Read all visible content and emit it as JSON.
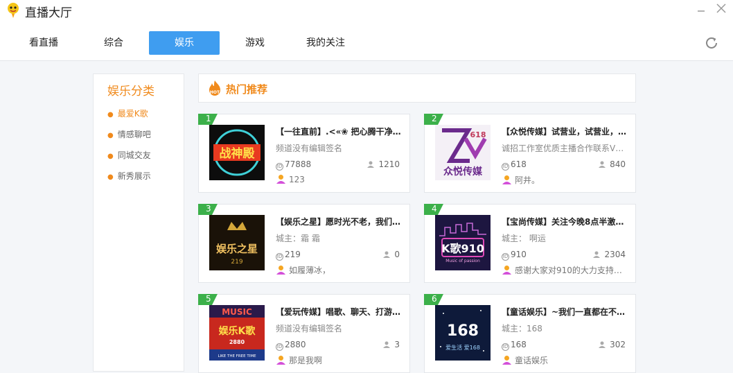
{
  "app": {
    "title": "直播大厅"
  },
  "tabs": [
    {
      "label": "看直播"
    },
    {
      "label": "综合"
    },
    {
      "label": "娱乐"
    },
    {
      "label": "游戏"
    },
    {
      "label": "我的关注"
    }
  ],
  "active_tab": "娱乐",
  "sidebar": {
    "title": "娱乐分类",
    "items": [
      {
        "label": "最爱K歌"
      },
      {
        "label": "情感聊吧"
      },
      {
        "label": "同城交友"
      },
      {
        "label": "新秀展示"
      }
    ],
    "active_item": "最爱K歌"
  },
  "section": {
    "title": "热门推荐",
    "badge": "HOT"
  },
  "cards": [
    {
      "rank": "1",
      "title": "【一往直前】.<«❀ 把心腾干净…",
      "subtitle": "频道没有编辑签名",
      "room_id": "77888",
      "viewers": "1210",
      "host": "123",
      "thumb_text": "战神殿"
    },
    {
      "rank": "2",
      "title": "【众悦传媒】试营业，试营业，…",
      "subtitle": "诚招工作室优质主播合作联系V…",
      "room_id": "618",
      "viewers": "840",
      "host": "阿井。",
      "thumb_text": "众悦传媒",
      "thumb_num": "618"
    },
    {
      "rank": "3",
      "title": "【娱乐之星】愿时光不老，我们…",
      "subtitle": "城主：霜 霜",
      "room_id": "219",
      "viewers": "0",
      "host": "如履薄冰，",
      "thumb_text": "娱乐之星",
      "thumb_num": "219"
    },
    {
      "rank": "4",
      "title": "【宝尚传媒】关注今晚8点半激…",
      "subtitle": "城主：  啊运",
      "room_id": "910",
      "viewers": "2304",
      "host": "感谢大家对910的大力支持！！",
      "thumb_text": "K歌910",
      "thumb_sub": "Music of passion"
    },
    {
      "rank": "5",
      "title": "【爱玩传媒】唱歌、聊天、打游…",
      "subtitle": "频道没有编辑签名",
      "room_id": "2880",
      "viewers": "3",
      "host": "那是我啊",
      "thumb_text": "娱乐K歌",
      "thumb_top": "MUSIC",
      "thumb_num": "2880",
      "thumb_sub": "LIKE THE FREE TIME"
    },
    {
      "rank": "6",
      "title": "【童话娱乐】~我们一直都在不…",
      "subtitle": "城主：168",
      "room_id": "168",
      "viewers": "302",
      "host": "童话娱乐",
      "thumb_text": "168",
      "thumb_sub": "爱生活 爱168"
    }
  ],
  "colors": {
    "accent": "#3f9df0",
    "orange": "#f08a1c",
    "rank_green": "#3cb04a"
  }
}
